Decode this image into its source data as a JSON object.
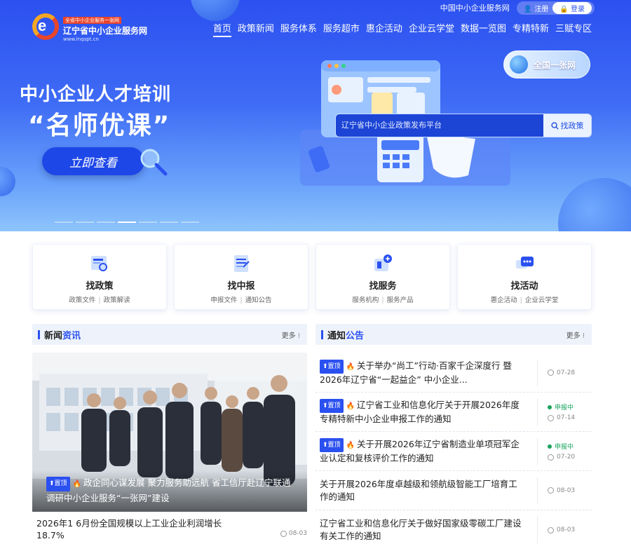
{
  "colors": {
    "brand": "#2b50f0",
    "status_green": "#19a45c",
    "hot_red": "#e8452b"
  },
  "header": {
    "site_name": "中国中小企业服务网",
    "register": "注册",
    "login": "登录",
    "logo": {
      "slogan": "全省中小企业服务一张网",
      "name": "辽宁省中小企业服务网",
      "url": "www.lnqspt.cn"
    },
    "nav": [
      {
        "label": "首页",
        "active": true
      },
      {
        "label": "政策新闻",
        "active": false
      },
      {
        "label": "服务体系",
        "active": false
      },
      {
        "label": "服务超市",
        "active": false
      },
      {
        "label": "惠企活动",
        "active": false
      },
      {
        "label": "企业云学堂",
        "active": false
      },
      {
        "label": "数据一览图",
        "active": false
      },
      {
        "label": "专精特新",
        "active": false
      },
      {
        "label": "三赋专区",
        "active": false
      }
    ]
  },
  "hero": {
    "title": "中小企业人才培训",
    "subtitle": "“名师优课”",
    "cta": "立即查看",
    "nationwide_label": "全国一张网",
    "search_placeholder": "辽宁省中小企业政策发布平台",
    "search_button": "找政策"
  },
  "quick_cards": [
    {
      "icon": "policy-icon",
      "title": "找政策",
      "sub1": "政策文件",
      "sub2": "政策解读"
    },
    {
      "icon": "bid-icon",
      "title": "找中报",
      "sub1": "申报文件",
      "sub2": "通知公告"
    },
    {
      "icon": "service-icon",
      "title": "找服务",
      "sub1": "服务机构",
      "sub2": "服务产品"
    },
    {
      "icon": "activity-icon",
      "title": "找活动",
      "sub1": "惠企活动",
      "sub2": "企业云学堂"
    }
  ],
  "news": {
    "title_a": "新闻",
    "title_b": "资讯",
    "more": "更多",
    "featured": {
      "tag": "置顶",
      "title": "政企同心谋发展 聚力服务助远航 省工信厅赴辽宁联通调研中小企业服务“一张网”建设"
    },
    "item": {
      "title": "2026年1 6月份全国规模以上工业企业利润增长18.7%",
      "date": "08-03"
    }
  },
  "notices": {
    "title_a": "通知",
    "title_b": "公告",
    "more": "更多",
    "items": [
      {
        "tag": "置顶",
        "hot": true,
        "title": "关于举办“尚工”行动·百家千企深度行 暨2026年辽宁省“一起益企” 中小企业...",
        "status": "",
        "date": "07-28"
      },
      {
        "tag": "置顶",
        "hot": true,
        "title": "辽宁省工业和信息化厅关于开展2026年度专精特新中小企业申报工作的通知",
        "status": "申报中",
        "date": "07-14"
      },
      {
        "tag": "置顶",
        "hot": true,
        "title": "关于开展2026年辽宁省制造业单项冠军企业认定和复核评价工作的通知",
        "status": "申报中",
        "date": "07-20"
      },
      {
        "tag": "",
        "hot": false,
        "title": "关于开展2026年度卓越级和领航级智能工厂培育工作的通知",
        "status": "",
        "date": "08-03"
      },
      {
        "tag": "",
        "hot": false,
        "title": "辽宁省工业和信息化厅关于做好国家级零碳工厂建设有关工作的通知",
        "status": "",
        "date": "08-03"
      }
    ]
  }
}
